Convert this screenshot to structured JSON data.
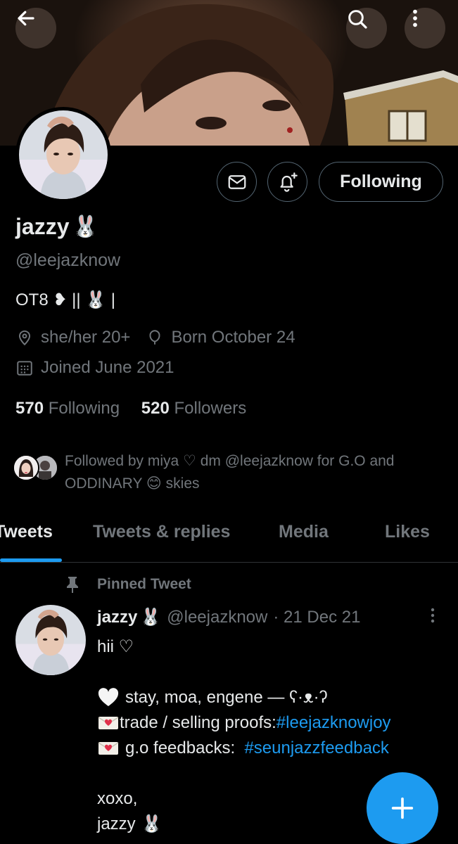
{
  "header": {
    "back_icon": "arrow-left-icon",
    "search_icon": "search-icon",
    "more_icon": "more-vertical-icon"
  },
  "profile": {
    "name": "jazzy",
    "name_emoji": "🐰",
    "handle": "@leejazknow",
    "bio": "OT8 ❥ || 🐰 |",
    "pronouns": "she/her 20+",
    "birthday": "Born October 24",
    "joined": "Joined June 2021",
    "following_count": "570",
    "following_label": "Following",
    "followers_count": "520",
    "followers_label": "Followers",
    "followed_by": "Followed by miya ♡ dm @leejazknow for G.O and ODDINARY 😊 skies"
  },
  "actions": {
    "message_icon": "envelope-icon",
    "notify_icon": "bell-plus-icon",
    "follow_label": "Following"
  },
  "tabs": [
    "Tweets",
    "Tweets & replies",
    "Media",
    "Likes"
  ],
  "active_tab": "Tweets",
  "pinned_tweet": {
    "pinned_label": "Pinned Tweet",
    "author_name": "jazzy",
    "author_emoji": "🐰",
    "author_handle": "@leejazknow",
    "date": "· 21 Dec 21",
    "lines": {
      "l1": "hii ♡",
      "l2_text": "stay, moa, engene — ʕ·ᴥ·ʔ",
      "l3_text": "trade / selling proofs: ",
      "l3_tag": "#leejazknowjoy",
      "l4_text": "g.o feedbacks:  ",
      "l4_tag": "#seunjazzfeedback",
      "l5": "xoxo,",
      "l6": "jazzy"
    }
  },
  "compose_button_icon": "plus-icon",
  "colors": {
    "accent": "#1d9bf0",
    "muted_text": "#71767b",
    "border": "#536471"
  }
}
